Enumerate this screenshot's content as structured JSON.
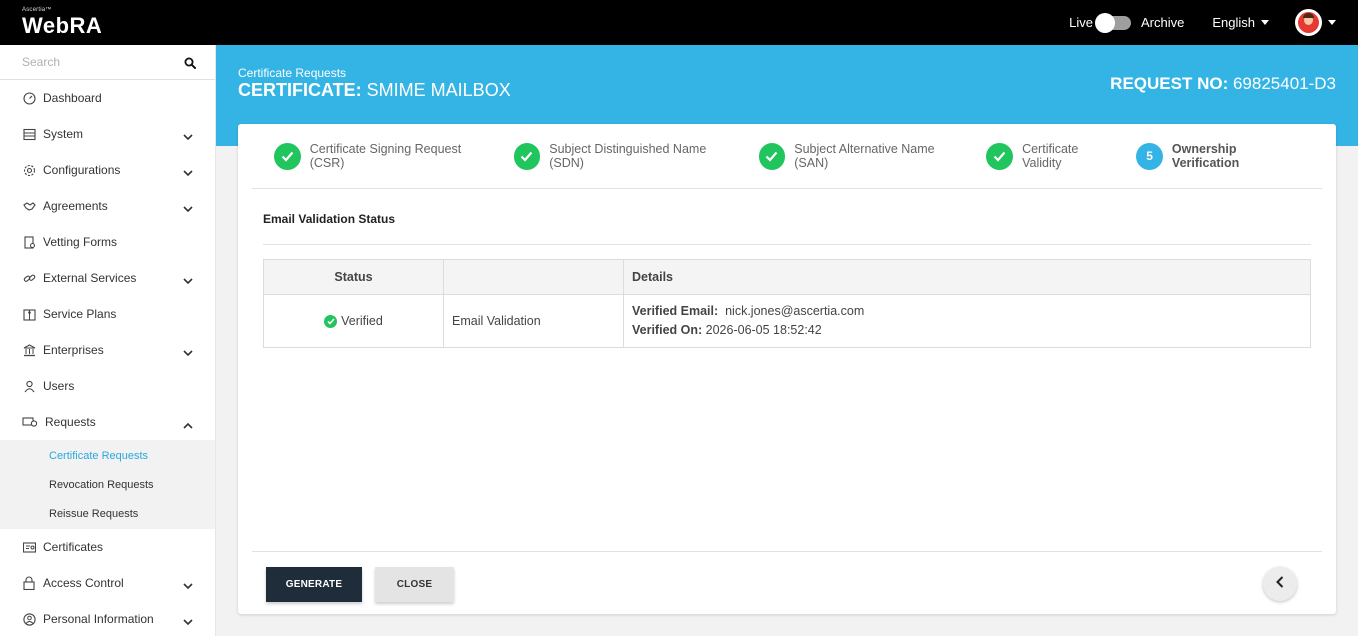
{
  "app": {
    "brand_small": "Ascertia™",
    "brand_main": "WebRA"
  },
  "topbar": {
    "live_label": "Live",
    "archive_label": "Archive",
    "language": "English"
  },
  "sidebar": {
    "search_placeholder": "Search",
    "items": [
      {
        "label": "Dashboard",
        "icon": "dashboard-icon",
        "expandable": false
      },
      {
        "label": "System",
        "icon": "system-icon",
        "expandable": true
      },
      {
        "label": "Configurations",
        "icon": "gear-icon",
        "expandable": true
      },
      {
        "label": "Agreements",
        "icon": "handshake-icon",
        "expandable": true
      },
      {
        "label": "Vetting Forms",
        "icon": "vetting-form-icon",
        "expandable": false
      },
      {
        "label": "External Services",
        "icon": "link-icon",
        "expandable": true
      },
      {
        "label": "Service Plans",
        "icon": "service-plan-icon",
        "expandable": false
      },
      {
        "label": "Enterprises",
        "icon": "bank-icon",
        "expandable": true
      },
      {
        "label": "Users",
        "icon": "user-icon",
        "expandable": false
      },
      {
        "label": "Requests",
        "icon": "requests-icon",
        "expandable": true
      }
    ],
    "sub_items": [
      {
        "label": "Certificate Requests",
        "active": true
      },
      {
        "label": "Revocation Requests",
        "active": false
      },
      {
        "label": "Reissue Requests",
        "active": false
      }
    ],
    "items_after": [
      {
        "label": "Certificates",
        "icon": "certificate-icon",
        "expandable": false
      },
      {
        "label": "Access Control",
        "icon": "lock-icon",
        "expandable": true
      },
      {
        "label": "Personal Information",
        "icon": "profile-icon",
        "expandable": true
      }
    ]
  },
  "header": {
    "breadcrumb": "Certificate Requests",
    "title_prefix": "CERTIFICATE:",
    "title_value": "SMIME MAILBOX",
    "request_no_label": "REQUEST NO:",
    "request_no_value": "69825401-D3"
  },
  "stepper": {
    "steps": [
      {
        "label": "Certificate Signing Request (CSR)",
        "state": "done"
      },
      {
        "label": "Subject Distinguished Name (SDN)",
        "state": "done"
      },
      {
        "label": "Subject Alternative Name (SAN)",
        "state": "done"
      },
      {
        "label": "Certificate Validity",
        "state": "done"
      },
      {
        "label": "Ownership Verification",
        "state": "current",
        "number": "5"
      }
    ]
  },
  "section": {
    "title": "Email Validation Status"
  },
  "table": {
    "headers": [
      "Status",
      "",
      "Details"
    ],
    "row": {
      "status": "Verified",
      "type": "Email Validation",
      "email_label": "Verified Email:",
      "email_value": "nick.jones@ascertia.com",
      "date_label": "Verified On:",
      "date_value": "2026-06-05 18:52:42"
    }
  },
  "buttons": {
    "generate": "GENERATE",
    "close": "CLOSE"
  },
  "colors": {
    "accent": "#34b4e5",
    "success": "#21c55d",
    "primary_button": "#1f2c3a",
    "active_link": "#29a8df"
  }
}
